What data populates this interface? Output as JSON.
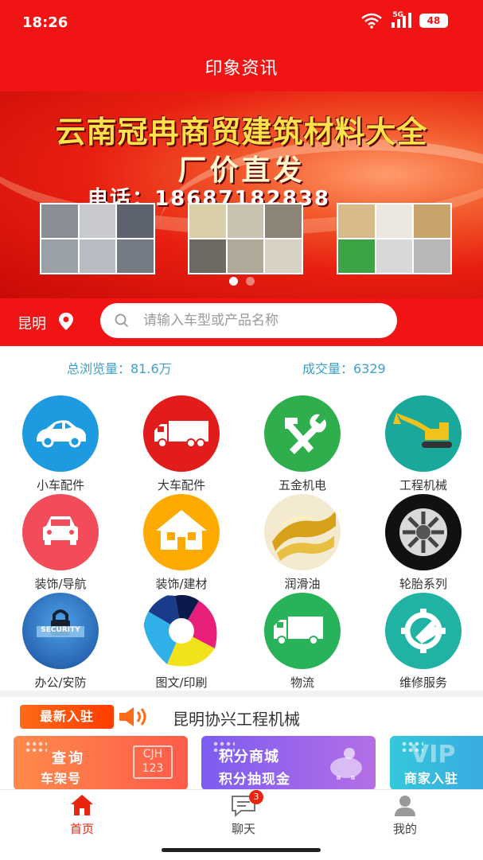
{
  "status_bar": {
    "time": "18:26",
    "network": "5G",
    "battery": "48"
  },
  "header": {
    "title": "印象资讯"
  },
  "banner": {
    "headline": "云南冠冉商贸建筑材料大全",
    "subline": "厂价直发",
    "phone": "电话：18687182838",
    "page_count": 2,
    "active_page": 1
  },
  "search": {
    "city": "昆明",
    "placeholder": "请输入车型或产品名称"
  },
  "stats": {
    "views": "总浏览量：81.6万",
    "deals": "成交量：6329"
  },
  "categories": [
    {
      "label": "小车配件",
      "icon": "car-icon",
      "color": "#1e9be0"
    },
    {
      "label": "大车配件",
      "icon": "truck-icon",
      "color": "#e21b1b"
    },
    {
      "label": "五金机电",
      "icon": "tools-icon",
      "color": "#2fae4e"
    },
    {
      "label": "工程机械",
      "icon": "excavator-icon",
      "color": "#1aa89a"
    },
    {
      "label": "装饰/导航",
      "icon": "car-front-icon",
      "color": "#f24c5a"
    },
    {
      "label": "装饰/建材",
      "icon": "house-icon",
      "color": "#ffaa00"
    },
    {
      "label": "润滑油",
      "icon": "oil-icon",
      "color": "#d7a21a"
    },
    {
      "label": "轮胎系列",
      "icon": "tire-icon",
      "color": "#111111"
    },
    {
      "label": "办公/安防",
      "icon": "security-lock-icon",
      "color": "#2a6fc9"
    },
    {
      "label": "图文/印刷",
      "icon": "print-color-icon",
      "color": "#1a3a8a"
    },
    {
      "label": "物流",
      "icon": "delivery-truck-icon",
      "color": "#28b25a"
    },
    {
      "label": "维修服务",
      "icon": "gear-wrench-icon",
      "color": "#20b3a3"
    }
  ],
  "security_text": "SECURITY",
  "newcomer": {
    "badge": "最新入驻",
    "company": "昆明协兴工程机械"
  },
  "promos": [
    {
      "line1": "查询",
      "line2": "车架号",
      "code_top": "CJH",
      "code_bottom": "123"
    },
    {
      "line1": "积分商城",
      "line2": "积分抽现金"
    },
    {
      "brand": "VIP",
      "line2": "商家入驻"
    }
  ],
  "bottom_nav": {
    "home": "首页",
    "chat": "聊天",
    "chat_badge": "3",
    "mine": "我的"
  },
  "colors": {
    "primary_red": "#f01414",
    "accent_blue": "#3f9fc7",
    "nav_active": "#e8260f"
  }
}
